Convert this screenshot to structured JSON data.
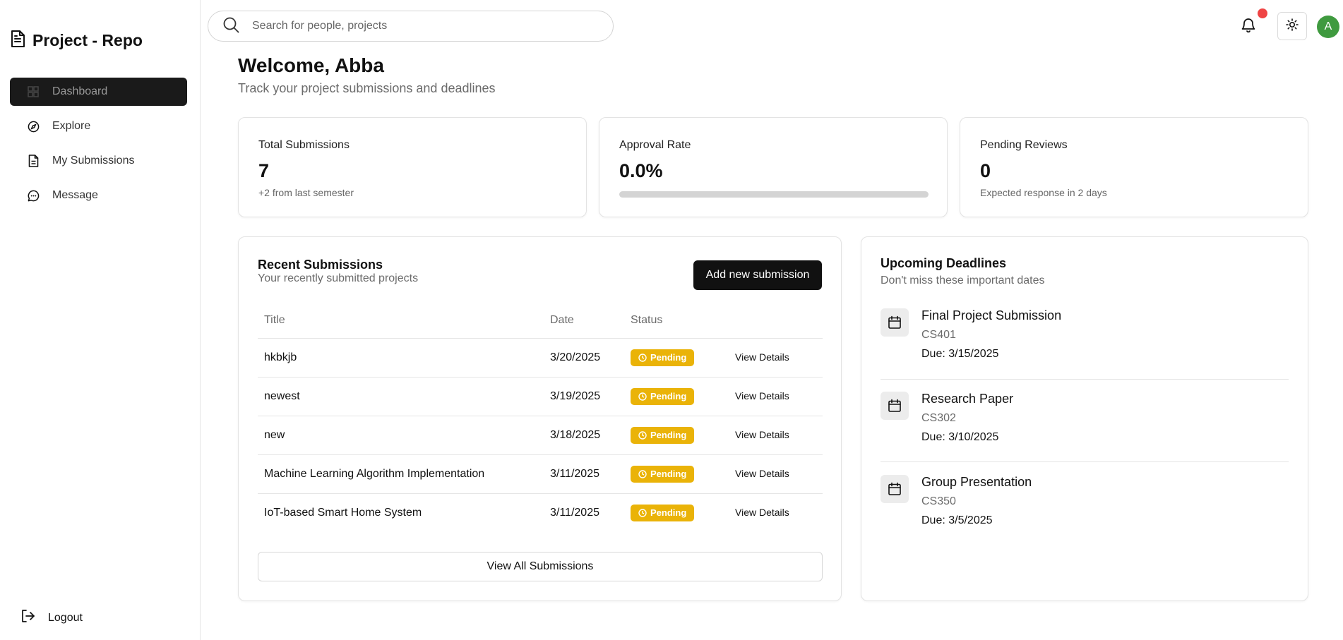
{
  "app": {
    "title": "Project - Repo"
  },
  "sidebar": {
    "items": [
      {
        "label": "Dashboard",
        "icon": "dashboard-icon",
        "active": true
      },
      {
        "label": "Explore",
        "icon": "compass-icon",
        "active": false
      },
      {
        "label": "My Submissions",
        "icon": "document-icon",
        "active": false
      },
      {
        "label": "Message",
        "icon": "message-icon",
        "active": false
      }
    ],
    "logout_label": "Logout"
  },
  "header": {
    "search_placeholder": "Search for people, projects",
    "avatar_initial": "A"
  },
  "welcome": {
    "title": "Welcome, Abba",
    "subtitle": "Track your project submissions and deadlines"
  },
  "stats": {
    "total": {
      "label": "Total Submissions",
      "value": "7",
      "note": "+2 from last semester"
    },
    "approval": {
      "label": "Approval Rate",
      "value": "0.0%",
      "progress": 0
    },
    "pending": {
      "label": "Pending Reviews",
      "value": "0",
      "note": "Expected response in 2 days"
    }
  },
  "recent": {
    "title": "Recent Submissions",
    "subtitle": "Your recently submitted projects",
    "add_label": "Add new submission",
    "columns": {
      "title": "Title",
      "date": "Date",
      "status": "Status"
    },
    "rows": [
      {
        "title": "hkbkjb",
        "date": "3/20/2025",
        "status": "Pending",
        "action": "View Details"
      },
      {
        "title": "newest",
        "date": "3/19/2025",
        "status": "Pending",
        "action": "View Details"
      },
      {
        "title": "new",
        "date": "3/18/2025",
        "status": "Pending",
        "action": "View Details"
      },
      {
        "title": "Machine Learning Algorithm Implementation",
        "date": "3/11/2025",
        "status": "Pending",
        "action": "View Details"
      },
      {
        "title": "IoT-based Smart Home System",
        "date": "3/11/2025",
        "status": "Pending",
        "action": "View Details"
      }
    ],
    "view_all_label": "View All Submissions"
  },
  "deadlines": {
    "title": "Upcoming Deadlines",
    "subtitle": "Don't miss these important dates",
    "items": [
      {
        "title": "Final Project Submission",
        "code": "CS401",
        "due": "Due: 3/15/2025"
      },
      {
        "title": "Research Paper",
        "code": "CS302",
        "due": "Due: 3/10/2025"
      },
      {
        "title": "Group Presentation",
        "code": "CS350",
        "due": "Due: 3/5/2025"
      }
    ]
  },
  "colors": {
    "accent": "#111111",
    "pending_badge": "#eab308",
    "notification_dot": "#ef4444",
    "avatar": "#3f9a3f"
  }
}
